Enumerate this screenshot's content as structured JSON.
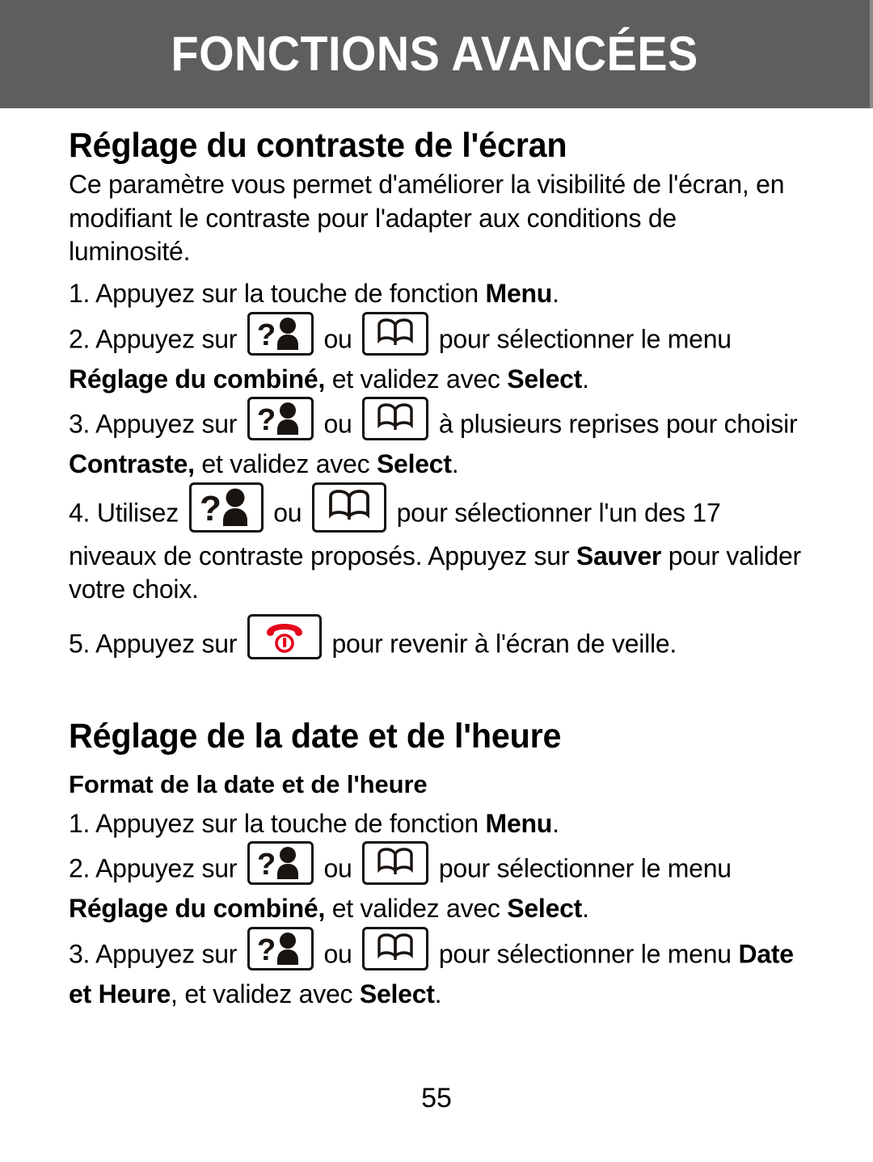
{
  "header": {
    "title": "FONCTIONS AVANCÉES",
    "background_color": "#5e5e5e",
    "text_color": "#ffffff"
  },
  "sections": [
    {
      "title": "Réglage du contraste de l'écran",
      "intro": "Ce paramètre vous permet d'améliorer la visibilité de l'écran, en modifiant le contraste pour l'adapter aux conditions de luminosité.",
      "steps": {
        "s1_pre": "1. Appuyez sur la touche de fonction ",
        "s1_bold": "Menu",
        "s1_post": ".",
        "s2_pre": "2. Appuyez sur ",
        "s2_mid": " ou ",
        "s2_post": " pour sélectionner le menu ",
        "s2_bold1": "Réglage du combiné,",
        "s2_tail": " et validez avec ",
        "s2_bold2": "Select",
        "s2_end": ".",
        "s3_pre": "3. Appuyez sur ",
        "s3_mid": " ou ",
        "s3_post": " à plusieurs reprises pour choisir ",
        "s3_bold1": "Contraste,",
        "s3_tail": " et validez avec ",
        "s3_bold2": "Select",
        "s3_end": ".",
        "s4_pre": "4. Utilisez ",
        "s4_mid": " ou ",
        "s4_post": " pour sélectionner l'un des 17 niveaux de contraste proposés. Appuyez sur ",
        "s4_bold1": "Sauver",
        "s4_tail": " pour valider votre choix.",
        "s5_pre": "5. Appuyez sur ",
        "s5_post": " pour revenir à l'écran de veille."
      }
    },
    {
      "title": "Réglage de la date et de l'heure",
      "subtitle": "Format de la date et de l'heure",
      "steps": {
        "s1_pre": "1. Appuyez sur la touche de fonction ",
        "s1_bold": "Menu",
        "s1_post": ".",
        "s2_pre": "2. Appuyez sur ",
        "s2_mid": " ou ",
        "s2_post": " pour sélectionner le menu ",
        "s2_bold1": "Réglage du combiné,",
        "s2_tail": " et validez avec ",
        "s2_bold2": "Select",
        "s2_end": ".",
        "s3_pre": "3. Appuyez sur ",
        "s3_mid": " ou ",
        "s3_post": " pour sélectionner le menu ",
        "s3_bold1": "Date et Heure",
        "s3_tail": ", et validez avec ",
        "s3_bold2": "Select",
        "s3_end": "."
      }
    }
  ],
  "icons": {
    "up_key": "question-person-key-icon",
    "down_key": "open-book-key-icon",
    "end_call_key": "end-call-key-icon",
    "end_call_color": "#e3051b"
  },
  "footer": {
    "page_number": "55"
  }
}
